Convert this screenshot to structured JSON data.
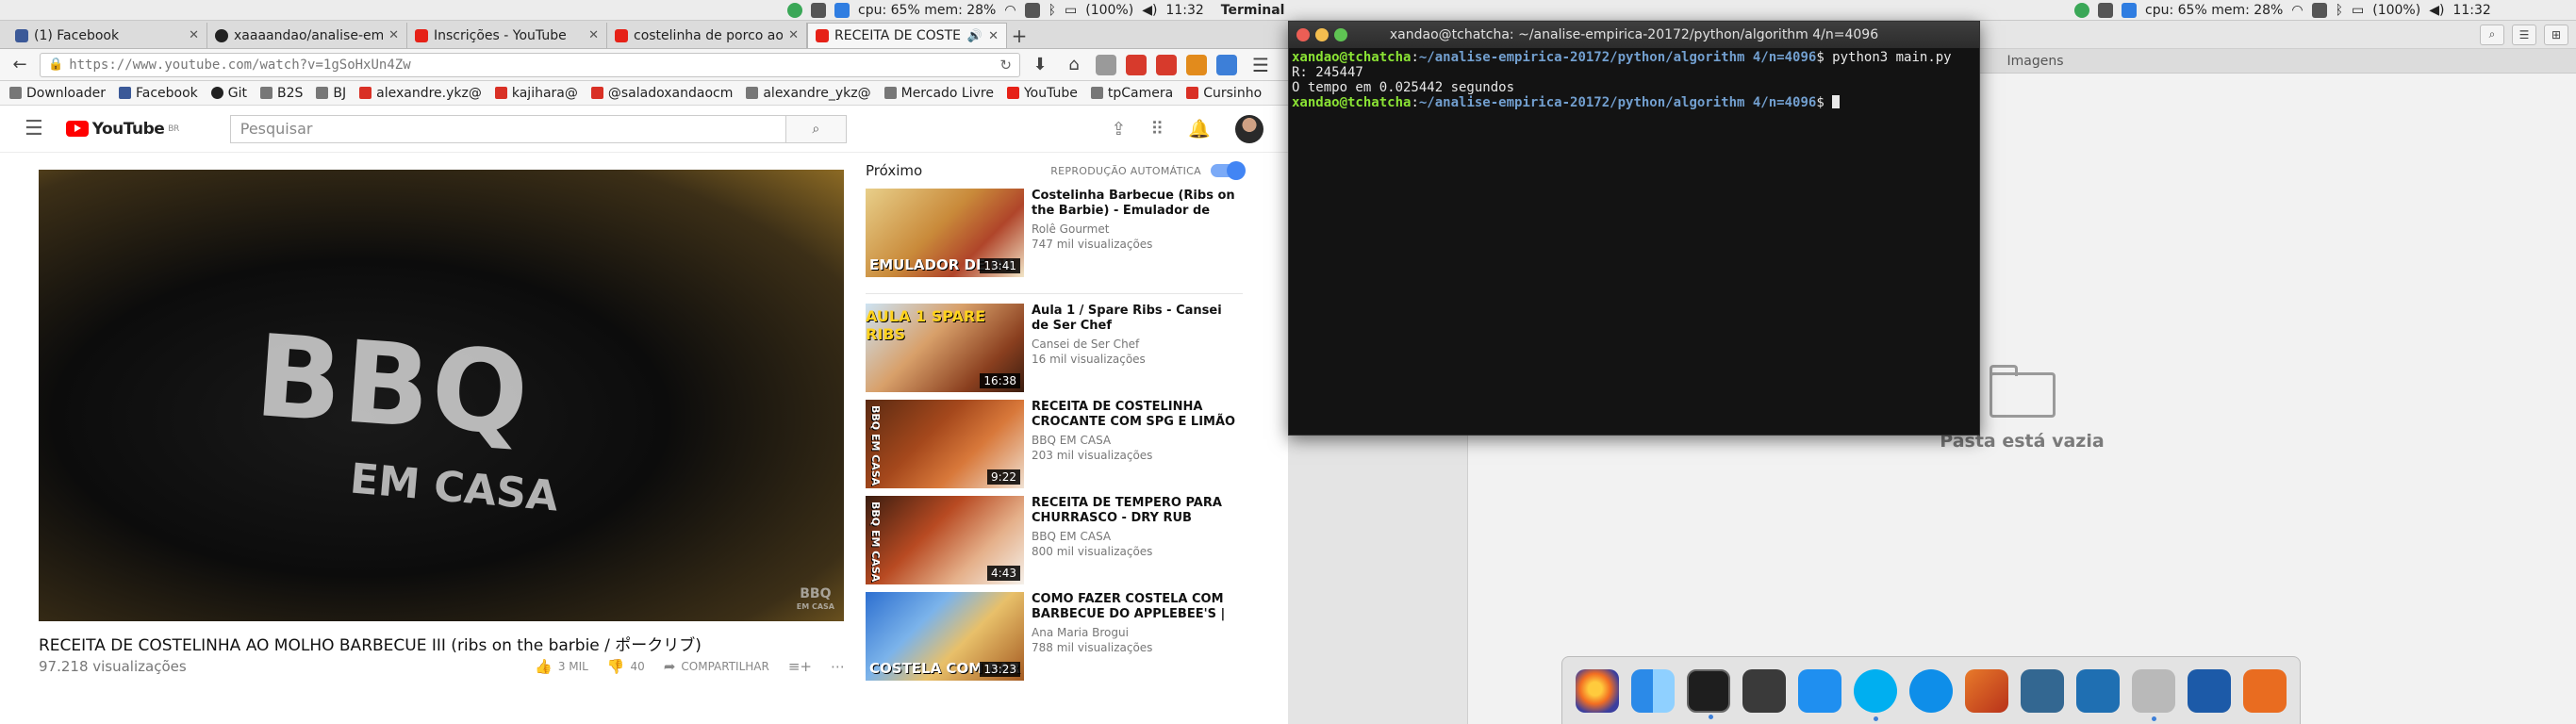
{
  "menubar": {
    "left_status": "cpu: 65% mem: 28%",
    "left_battery": "(100%)",
    "left_time": "11:32",
    "active_app": "Terminal",
    "right_status": "cpu: 65% mem: 28%",
    "right_battery": "(100%)",
    "right_time": "11:32"
  },
  "browser": {
    "tabs": [
      {
        "label": "(1) Facebook",
        "favicon": "facebook-icon"
      },
      {
        "label": "xaaaandao/analise-em",
        "favicon": "github-icon"
      },
      {
        "label": "Inscrições - YouTube",
        "favicon": "youtube-icon"
      },
      {
        "label": "costelinha de porco ao",
        "favicon": "youtube-icon"
      },
      {
        "label": "RECEITA DE COSTEL",
        "favicon": "youtube-icon"
      }
    ],
    "url": "https://www.youtube.com/watch?v=1gSoHxUn4Zw",
    "bookmarks": [
      {
        "label": "Downloader",
        "icon": "gear-icon"
      },
      {
        "label": "Facebook",
        "icon": "facebook-icon"
      },
      {
        "label": "Git",
        "icon": "github-icon"
      },
      {
        "label": "B2S",
        "icon": "b2s-icon"
      },
      {
        "label": "BJ",
        "icon": "bj-icon"
      },
      {
        "label": "alexandre.ykz@",
        "icon": "gmail-icon"
      },
      {
        "label": "kajihara@",
        "icon": "gmail-icon"
      },
      {
        "label": "@saladoxandaocm",
        "icon": "gmail-icon"
      },
      {
        "label": "alexandre_ykz@",
        "icon": "outlook-icon"
      },
      {
        "label": "Mercado Livre",
        "icon": "mercadolivre-icon"
      },
      {
        "label": "YouTube",
        "icon": "youtube-icon"
      },
      {
        "label": "tpCamera",
        "icon": "tpcamera-icon"
      },
      {
        "label": "Cursinho",
        "icon": "cursinho-icon"
      }
    ]
  },
  "youtube": {
    "logo": "YouTube",
    "logo_country": "BR",
    "search_placeholder": "Pesquisar",
    "player_shirt_text": "BBQ",
    "player_shirt_sub": "EM CASA",
    "player_watermark": "BBQ",
    "player_watermark_sub": "EM CASA",
    "video_title": "RECEITA DE COSTELINHA AO MOLHO BARBECUE III (ribs on the barbie / ポークリブ)",
    "views": "97.218 visualizações",
    "likes": "3 MIL",
    "dislikes": "40",
    "share": "COMPARTILHAR",
    "up_next": "Próximo",
    "autoplay": "REPRODUÇÃO AUTOMÁTICA",
    "recommendations": [
      {
        "title": "Costelinha Barbecue (Ribs on the Barbie) - Emulador de",
        "channel": "Rolê Gourmet",
        "views": "747 mil visualizações",
        "duration": "13:41",
        "caption": "EMULADOR DE OU"
      },
      {
        "title": "Aula 1 / Spare Ribs - Cansei de Ser Chef",
        "channel": "Cansei de Ser Chef",
        "views": "16 mil visualizações",
        "duration": "16:38",
        "caption": "AULA 1 SPARE RIBS"
      },
      {
        "title": "RECEITA DE COSTELINHA CROCANTE COM SPG E LIMÃO",
        "channel": "BBQ EM CASA",
        "views": "203 mil visualizações",
        "duration": "9:22",
        "caption": "BBQ EM CASA"
      },
      {
        "title": "RECEITA DE TEMPERO PARA CHURRASCO - DRY RUB",
        "channel": "BBQ EM CASA",
        "views": "800 mil visualizações",
        "duration": "4:43",
        "caption": "BBQ EM CASA"
      },
      {
        "title": "COMO FAZER COSTELA COM BARBECUE DO APPLEBEE'S |",
        "channel": "Ana Maria Brogui",
        "views": "788 mil visualizações",
        "duration": "13:23",
        "caption": "COSTELA COM BAR"
      }
    ]
  },
  "terminal": {
    "title": "xandao@tchatcha: ~/analise-empirica-20172/python/algorithm 4/n=4096",
    "user1": "xandao@tchatcha",
    "path1": "~/analise-empirica-20172/python/algorithm 4/n=4096",
    "cmd1": "$ python3 main.py",
    "out1": "R: 245447",
    "out2": "O tempo em 0.025442 segundos",
    "user2": "xandao@tchatcha",
    "path2": "~/analise-empirica-20172/python/algorithm 4/n=4096",
    "prompt2": "$ "
  },
  "files": {
    "tab_label": "Imagens",
    "empty_text": "Pasta está vazia"
  },
  "dock": {
    "apps": [
      "firefox-icon",
      "finder-icon",
      "terminal-icon",
      "code-editor-icon",
      "dropbox-icon",
      "skype-icon",
      "teamviewer-icon",
      "matlab-icon",
      "postgresql-icon",
      "mysql-workbench-icon",
      "file-manager-icon",
      "virtualbox-icon",
      "git-gui-icon"
    ]
  },
  "colors": {
    "youtube_red": "#ff0000",
    "terminal_user": "#8ae234",
    "terminal_path": "#729fcf",
    "autoplay_blue": "#4285f4"
  }
}
